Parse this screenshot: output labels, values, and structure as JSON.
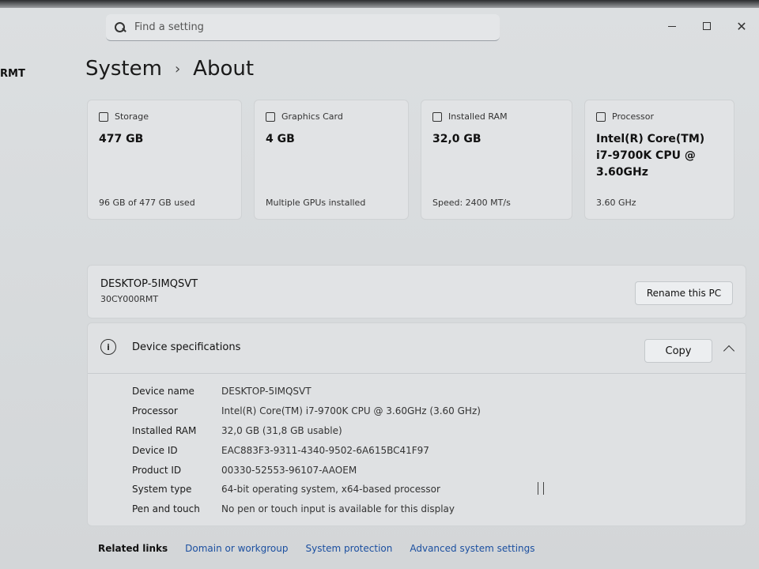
{
  "sidebar": {
    "fragment": "RMT"
  },
  "search": {
    "placeholder": "Find a setting"
  },
  "breadcrumb": {
    "parent": "System",
    "separator": "›",
    "current": "About"
  },
  "cards": [
    {
      "title": "Storage",
      "icon": "storage-icon",
      "value": "477 GB",
      "sub": "96 GB of 477 GB used"
    },
    {
      "title": "Graphics Card",
      "icon": "graphics-card-icon",
      "value": "4 GB",
      "sub": "Multiple GPUs installed"
    },
    {
      "title": "Installed RAM",
      "icon": "ram-icon",
      "value": "32,0 GB",
      "sub": "Speed: 2400 MT/s"
    },
    {
      "title": "Processor",
      "icon": "processor-icon",
      "value": "Intel(R) Core(TM) i7-9700K CPU @ 3.60GHz",
      "sub": "3.60 GHz"
    }
  ],
  "pc": {
    "name": "DESKTOP-5IMQSVT",
    "model": "30CY000RMT",
    "rename_label": "Rename this PC"
  },
  "specs": {
    "title": "Device specifications",
    "copy_label": "Copy",
    "rows": [
      {
        "label": "Device name",
        "value": "DESKTOP-5IMQSVT"
      },
      {
        "label": "Processor",
        "value": "Intel(R) Core(TM) i7-9700K CPU @ 3.60GHz (3.60 GHz)"
      },
      {
        "label": "Installed RAM",
        "value": "32,0 GB (31,8 GB usable)"
      },
      {
        "label": "Device ID",
        "value": "EAC883F3-9311-4340-9502-6A615BC41F97"
      },
      {
        "label": "Product ID",
        "value": "00330-52553-96107-AAOEM"
      },
      {
        "label": "System type",
        "value": "64-bit operating system, x64-based processor"
      },
      {
        "label": "Pen and touch",
        "value": "No pen or touch input is available for this display"
      }
    ]
  },
  "related": {
    "title": "Related links",
    "links": [
      "Domain or workgroup",
      "System protection",
      "Advanced system settings"
    ]
  }
}
